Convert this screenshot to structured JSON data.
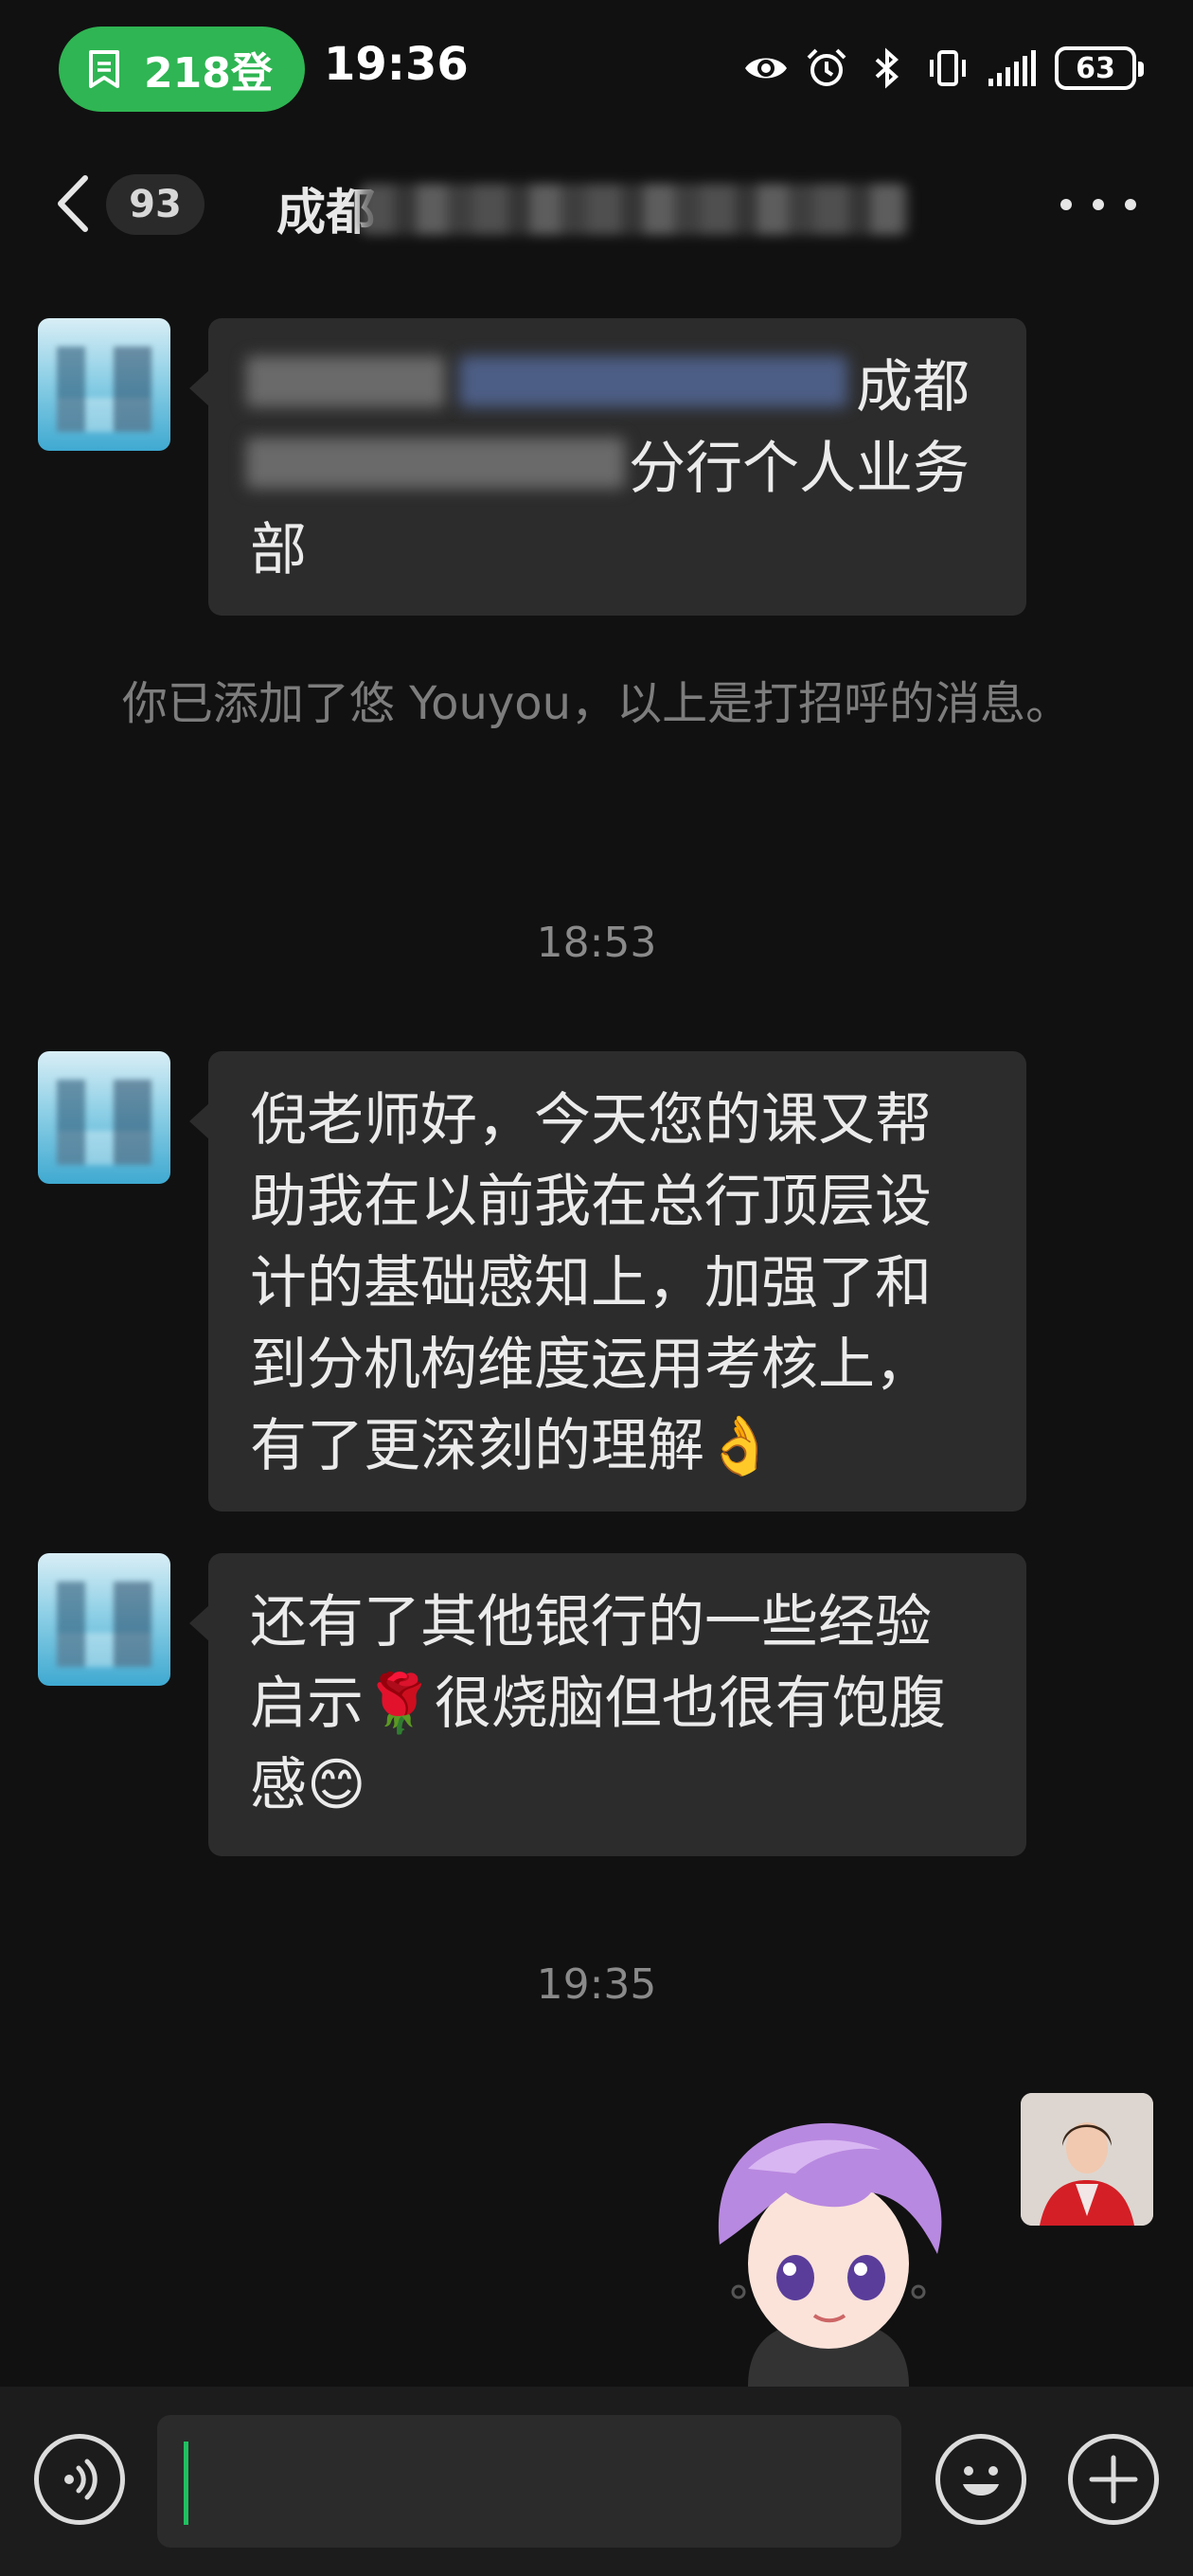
{
  "status_bar": {
    "notification_text": "218登",
    "time": "19:36",
    "battery": "63",
    "icons": [
      "eye-icon",
      "alarm-icon",
      "bluetooth-icon",
      "vibrate-icon",
      "signal-icon",
      "battery-icon"
    ],
    "notification_color": "#2fb553"
  },
  "header": {
    "back_icon": "chevron-left-icon",
    "unread_count": "93",
    "title_visible": "成都",
    "more_icon": "more-dots-icon"
  },
  "messages": [
    {
      "type": "received",
      "text_visible": "成都",
      "text_line2": "分行个人业务",
      "text_line3": "部"
    },
    {
      "type": "system",
      "text": "你已添加了悠 Youyou，以上是打招呼的消息。"
    },
    {
      "type": "timestamp",
      "text": "18:53"
    },
    {
      "type": "received",
      "text": "倪老师好，今天您的课又帮助我在以前我在总行顶层设计的基础感知上，加强了和到分机构维度运用考核上，有了更深刻的理解👌"
    },
    {
      "type": "received",
      "text": "还有了其他银行的一些经验启示🌹很烧脑但也很有饱腹感😊"
    },
    {
      "type": "timestamp",
      "text": "19:35"
    },
    {
      "type": "sent-sticker",
      "sticker": "purple-hair-cartoon-sticker"
    }
  ],
  "input_bar": {
    "value": "",
    "voice_icon": "voice-icon",
    "emoji_icon": "emoji-icon",
    "plus_icon": "plus-icon",
    "accent_color": "#20c060"
  },
  "colors": {
    "background": "#111111",
    "bubble_received": "#2c2c2c",
    "system_text": "#7d7d7d"
  }
}
